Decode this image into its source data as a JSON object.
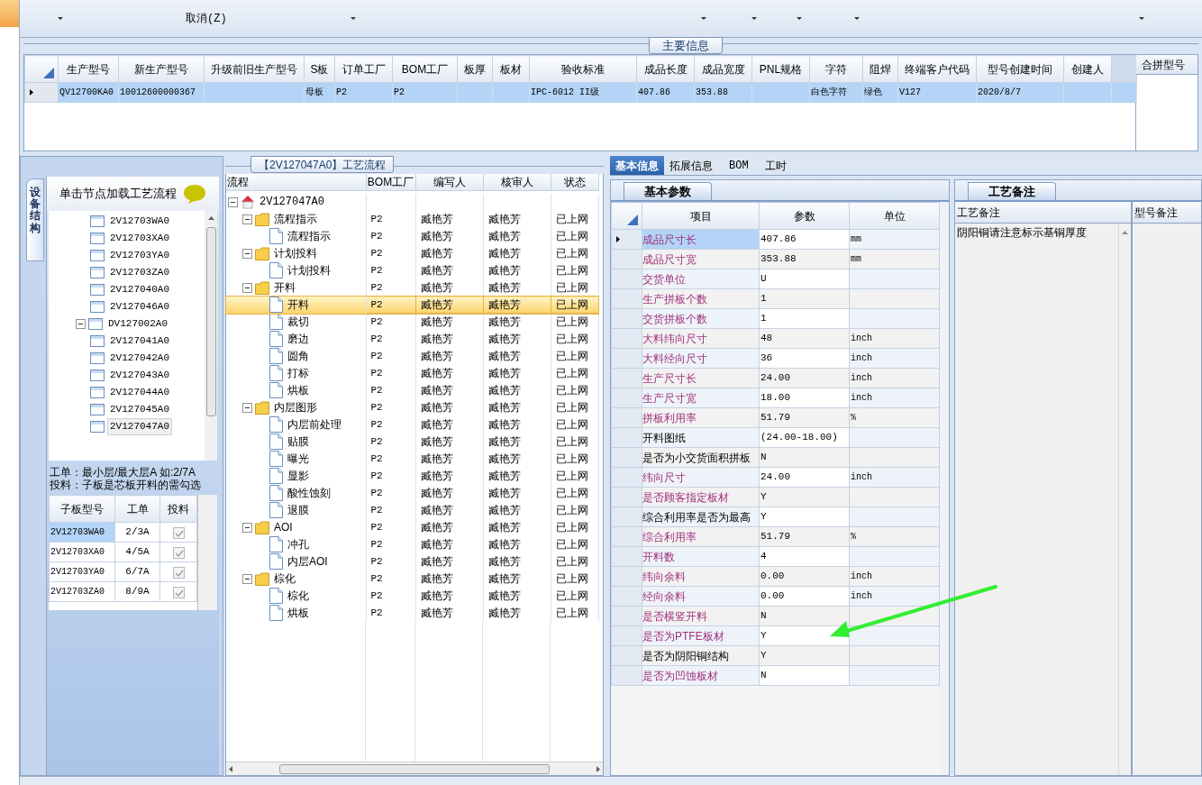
{
  "toolbar": {
    "buttons": [
      "取消(Z)"
    ]
  },
  "main_info": {
    "title": "主要信息",
    "columns": [
      "生产型号",
      "新生产型号",
      "升级前旧生产型号",
      "S板",
      "订单工厂",
      "BOM工厂",
      "板厚",
      "板材",
      "验收标准",
      "成品长度",
      "成品宽度",
      "PNL规格",
      "字符",
      "阻焊",
      "终端客户代码",
      "型号创建时间",
      "创建人"
    ],
    "rows": [
      {
        "selected": true,
        "cells": [
          "QV12700KA0",
          "10012600000367",
          null,
          "母板",
          "P2",
          "P2",
          null,
          null,
          "IPC-6012 II级",
          "407.86",
          "353.88",
          null,
          "白色字符",
          "绿色",
          "V127",
          "2020/8/7",
          null
        ]
      }
    ],
    "side_title": "合拼型号"
  },
  "left_panel": {
    "vertical_tab": "设备结构",
    "header": "单击节点加载工艺流程",
    "tree": [
      {
        "label": "2V12703WA0",
        "selected": false
      },
      {
        "label": "2V12703XA0",
        "selected": false
      },
      {
        "label": "2V12703YA0",
        "selected": false
      },
      {
        "label": "2V12703ZA0",
        "selected": false
      },
      {
        "label": "2V127040A0",
        "selected": false
      },
      {
        "label": "2V127046A0",
        "selected": false
      },
      {
        "label": "DV127002A0",
        "selected": false,
        "expanded": true,
        "children": [
          {
            "label": "2V127041A0",
            "selected": false
          },
          {
            "label": "2V127042A0",
            "selected": false
          },
          {
            "label": "2V127043A0",
            "selected": false
          },
          {
            "label": "2V127044A0",
            "selected": false
          },
          {
            "label": "2V127045A0",
            "selected": false
          },
          {
            "label": "2V127047A0",
            "selected": true
          }
        ]
      }
    ],
    "note_lines": [
      "工单：最小层/最大层A 如:2/7A",
      "投料：子板是芯板开料的需勾选"
    ],
    "sub_table": {
      "columns": [
        "子板型号",
        "工单",
        "投料"
      ],
      "rows": [
        {
          "model": "2V12703WA0",
          "order": "2/3A",
          "checked": true,
          "selected": true
        },
        {
          "model": "2V12703XA0",
          "order": "4/5A",
          "checked": true,
          "selected": false
        },
        {
          "model": "2V12703YA0",
          "order": "6/7A",
          "checked": true,
          "selected": false
        },
        {
          "model": "2V12703ZA0",
          "order": "8/9A",
          "checked": true,
          "selected": false
        }
      ]
    }
  },
  "process_panel": {
    "title": "【2V127047A0】工艺流程",
    "columns": [
      "流程",
      "BOM工厂",
      "编写人",
      "核审人",
      "状态"
    ],
    "tree": [
      {
        "kind": "root",
        "label": "2V127047A0",
        "expanded": true,
        "selected": false,
        "children": [
          {
            "kind": "folder",
            "label": "流程指示",
            "bom": "P2",
            "writer": "臧艳芳",
            "reviewer": "臧艳芳",
            "status": "已上网",
            "expanded": true,
            "selected": false,
            "children": [
              {
                "kind": "step",
                "label": "流程指示",
                "bom": "P2",
                "writer": "臧艳芳",
                "reviewer": "臧艳芳",
                "status": "已上网",
                "selected": false
              }
            ]
          },
          {
            "kind": "folder",
            "label": "计划投料",
            "bom": "P2",
            "writer": "臧艳芳",
            "reviewer": "臧艳芳",
            "status": "已上网",
            "expanded": true,
            "selected": false,
            "children": [
              {
                "kind": "step",
                "label": "计划投料",
                "bom": "P2",
                "writer": "臧艳芳",
                "reviewer": "臧艳芳",
                "status": "已上网",
                "selected": false
              }
            ]
          },
          {
            "kind": "folder",
            "label": "开料",
            "bom": "P2",
            "writer": "臧艳芳",
            "reviewer": "臧艳芳",
            "status": "已上网",
            "expanded": true,
            "selected": false,
            "children": [
              {
                "kind": "step",
                "label": "开料",
                "bom": "P2",
                "writer": "臧艳芳",
                "reviewer": "臧艳芳",
                "status": "已上网",
                "selected": true
              },
              {
                "kind": "step",
                "label": "裁切",
                "bom": "P2",
                "writer": "臧艳芳",
                "reviewer": "臧艳芳",
                "status": "已上网",
                "selected": false
              },
              {
                "kind": "step",
                "label": "磨边",
                "bom": "P2",
                "writer": "臧艳芳",
                "reviewer": "臧艳芳",
                "status": "已上网",
                "selected": false
              },
              {
                "kind": "step",
                "label": "圆角",
                "bom": "P2",
                "writer": "臧艳芳",
                "reviewer": "臧艳芳",
                "status": "已上网",
                "selected": false
              },
              {
                "kind": "step",
                "label": "打标",
                "bom": "P2",
                "writer": "臧艳芳",
                "reviewer": "臧艳芳",
                "status": "已上网",
                "selected": false
              },
              {
                "kind": "step",
                "label": "烘板",
                "bom": "P2",
                "writer": "臧艳芳",
                "reviewer": "臧艳芳",
                "status": "已上网",
                "selected": false
              }
            ]
          },
          {
            "kind": "folder",
            "label": "内层图形",
            "bom": "P2",
            "writer": "臧艳芳",
            "reviewer": "臧艳芳",
            "status": "已上网",
            "expanded": true,
            "selected": false,
            "children": [
              {
                "kind": "step",
                "label": "内层前处理",
                "bom": "P2",
                "writer": "臧艳芳",
                "reviewer": "臧艳芳",
                "status": "已上网",
                "selected": false
              },
              {
                "kind": "step",
                "label": "贴膜",
                "bom": "P2",
                "writer": "臧艳芳",
                "reviewer": "臧艳芳",
                "status": "已上网",
                "selected": false
              },
              {
                "kind": "step",
                "label": "曝光",
                "bom": "P2",
                "writer": "臧艳芳",
                "reviewer": "臧艳芳",
                "status": "已上网",
                "selected": false
              },
              {
                "kind": "step",
                "label": "显影",
                "bom": "P2",
                "writer": "臧艳芳",
                "reviewer": "臧艳芳",
                "status": "已上网",
                "selected": false
              },
              {
                "kind": "step",
                "label": "酸性蚀刻",
                "bom": "P2",
                "writer": "臧艳芳",
                "reviewer": "臧艳芳",
                "status": "已上网",
                "selected": false
              },
              {
                "kind": "step",
                "label": "退膜",
                "bom": "P2",
                "writer": "臧艳芳",
                "reviewer": "臧艳芳",
                "status": "已上网",
                "selected": false
              }
            ]
          },
          {
            "kind": "folder",
            "label": "AOI",
            "bom": "P2",
            "writer": "臧艳芳",
            "reviewer": "臧艳芳",
            "status": "已上网",
            "expanded": true,
            "selected": false,
            "children": [
              {
                "kind": "step",
                "label": "冲孔",
                "bom": "P2",
                "writer": "臧艳芳",
                "reviewer": "臧艳芳",
                "status": "已上网",
                "selected": false
              },
              {
                "kind": "step",
                "label": "内层AOI",
                "bom": "P2",
                "writer": "臧艳芳",
                "reviewer": "臧艳芳",
                "status": "已上网",
                "selected": false
              }
            ]
          },
          {
            "kind": "folder",
            "label": "棕化",
            "bom": "P2",
            "writer": "臧艳芳",
            "reviewer": "臧艳芳",
            "status": "已上网",
            "expanded": true,
            "selected": false,
            "children": [
              {
                "kind": "step",
                "label": "棕化",
                "bom": "P2",
                "writer": "臧艳芳",
                "reviewer": "臧艳芳",
                "status": "已上网",
                "selected": false
              },
              {
                "kind": "step",
                "label": "烘板",
                "bom": "P2",
                "writer": "臧艳芳",
                "reviewer": "臧艳芳",
                "status": "已上网",
                "selected": false
              }
            ]
          }
        ]
      }
    ]
  },
  "detail": {
    "tabs": [
      {
        "label": "基本信息",
        "selected": true
      },
      {
        "label": "拓展信息",
        "selected": false
      },
      {
        "label": "BOM",
        "selected": false
      },
      {
        "label": "工时",
        "selected": false
      }
    ],
    "sub_tab": "基本参数",
    "columns": [
      "项目",
      "参数",
      "单位"
    ],
    "rows": [
      {
        "label": "成品尺寸长",
        "value": "407.86",
        "unit": "mm",
        "required": true,
        "selected": true
      },
      {
        "label": "成品尺寸宽",
        "value": "353.88",
        "unit": "mm",
        "required": true,
        "selected": false
      },
      {
        "label": "交货单位",
        "value": "U",
        "required": true,
        "selected": false
      },
      {
        "label": "生产拼板个数",
        "value": "1",
        "required": true,
        "selected": false
      },
      {
        "label": "交货拼板个数",
        "value": "1",
        "required": true,
        "selected": false
      },
      {
        "label": "大料纬向尺寸",
        "value": "48",
        "unit": "inch",
        "required": true,
        "selected": false
      },
      {
        "label": "大料经向尺寸",
        "value": "36",
        "unit": "inch",
        "required": true,
        "selected": false
      },
      {
        "label": "生产尺寸长",
        "value": "24.00",
        "unit": "inch",
        "required": true,
        "selected": false
      },
      {
        "label": "生产尺寸宽",
        "value": "18.00",
        "unit": "inch",
        "required": true,
        "selected": false
      },
      {
        "label": "拼板利用率",
        "value": "51.79",
        "unit": "%",
        "required": true,
        "selected": false
      },
      {
        "label": "开料图纸",
        "value": "(24.00-18.00)",
        "required": false,
        "selected": false
      },
      {
        "label": "是否为小交货面积拼板",
        "value": "N",
        "required": false,
        "selected": false
      },
      {
        "label": "纬向尺寸",
        "value": "24.00",
        "unit": "inch",
        "required": true,
        "selected": false
      },
      {
        "label": "是否顾客指定板材",
        "value": "Y",
        "required": true,
        "selected": false
      },
      {
        "label": "综合利用率是否为最高",
        "value": "Y",
        "required": false,
        "selected": false
      },
      {
        "label": "综合利用率",
        "value": "51.79",
        "unit": "%",
        "required": true,
        "selected": false
      },
      {
        "label": "开料数",
        "value": "4",
        "required": true,
        "selected": false
      },
      {
        "label": "纬向余料",
        "value": "0.00",
        "unit": "inch",
        "required": true,
        "selected": false
      },
      {
        "label": "经向余料",
        "value": "0.00",
        "unit": "inch",
        "required": true,
        "selected": false
      },
      {
        "label": "是否横竖开料",
        "value": "N",
        "required": true,
        "selected": false
      },
      {
        "label": "是否为PTFE板材",
        "value": "Y",
        "required": true,
        "selected": false
      },
      {
        "label": "是否为阴阳铜结构",
        "value": "Y",
        "required": false,
        "selected": false
      },
      {
        "label": "是否为凹蚀板材",
        "value": "N",
        "required": true,
        "selected": false
      }
    ]
  },
  "remarks": {
    "tab": "工艺备注",
    "columns": [
      "工艺备注",
      "型号备注"
    ],
    "process_note": "阴阳铜请注意标示基铜厚度"
  }
}
